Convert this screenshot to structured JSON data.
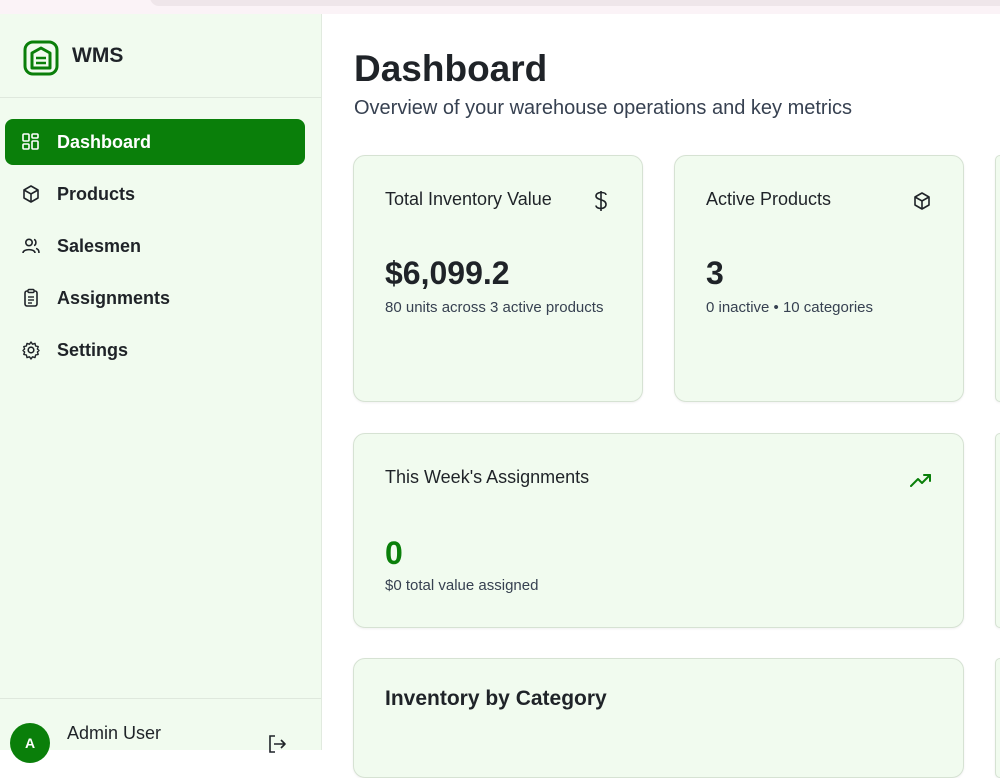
{
  "brand": {
    "name": "WMS",
    "icon": "warehouse-icon"
  },
  "sidebar": {
    "items": [
      {
        "label": "Dashboard",
        "icon": "dashboard-grid-icon",
        "active": true
      },
      {
        "label": "Products",
        "icon": "package-icon",
        "active": false
      },
      {
        "label": "Salesmen",
        "icon": "users-icon",
        "active": false
      },
      {
        "label": "Assignments",
        "icon": "clipboard-icon",
        "active": false
      },
      {
        "label": "Settings",
        "icon": "gear-icon",
        "active": false
      }
    ]
  },
  "user": {
    "initial": "A",
    "name": "Admin User",
    "logout_icon": "logout-icon"
  },
  "header": {
    "title": "Dashboard",
    "subtitle": "Overview of your warehouse operations and key metrics"
  },
  "cards": {
    "inventory_value": {
      "title": "Total Inventory Value",
      "value": "$6,099.2",
      "sub": "80 units across 3 active products",
      "icon": "dollar-icon"
    },
    "active_products": {
      "title": "Active Products",
      "value": "3",
      "sub": "0 inactive • 10 categories",
      "icon": "package-icon"
    },
    "week_assignments": {
      "title": "This Week's Assignments",
      "value": "0",
      "sub": "$0 total value assigned",
      "icon": "trending-up-icon"
    },
    "inventory_by_category": {
      "title": "Inventory by Category"
    }
  },
  "colors": {
    "accent": "#0a7f0a",
    "sidebar_bg": "#f1fbef",
    "card_bg": "#f1fbef",
    "text": "#1f2328"
  }
}
